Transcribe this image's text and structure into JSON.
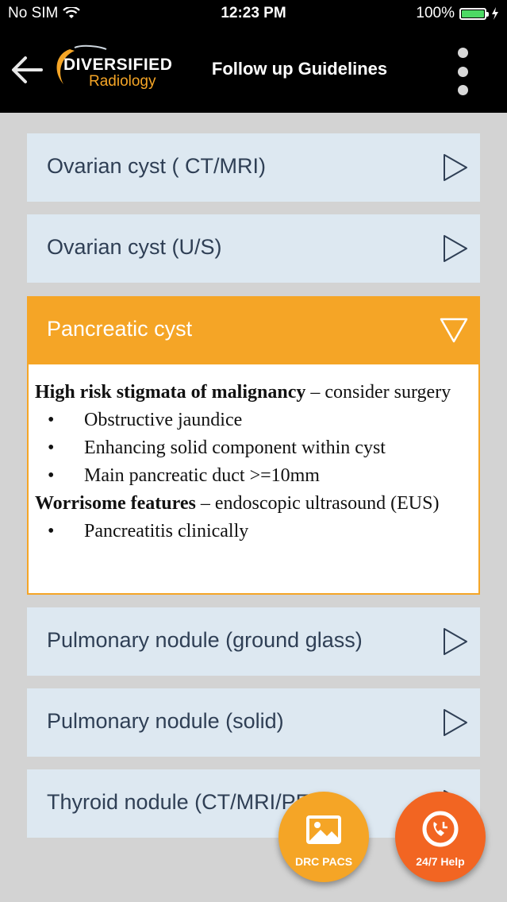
{
  "status": {
    "carrier": "No SIM",
    "time": "12:23 PM",
    "battery": "100%"
  },
  "header": {
    "logo_line1": "DIVERSIFIED",
    "logo_line2": "Radiology",
    "title": "Follow up Guidelines",
    "back_icon": "arrow-left-icon",
    "menu_icon": "vertical-dots-icon"
  },
  "colors": {
    "accent": "#f5a526",
    "row_bg": "#dde8f1",
    "text": "#2f3f55",
    "help": "#f26522"
  },
  "list": {
    "items": [
      {
        "label": "Ovarian cyst ( CT/MRI)"
      },
      {
        "label": "Ovarian cyst (U/S)"
      },
      {
        "label": "Pancreatic cyst"
      },
      {
        "label": "Pulmonary nodule (ground glass)"
      },
      {
        "label": "Pulmonary nodule (solid)"
      },
      {
        "label": "Thyroid nodule (CT/MRI/PET)"
      }
    ]
  },
  "detail": {
    "heading1": "High risk stigmata of malignancy",
    "heading1_rest": " – consider surgery",
    "list1": [
      "Obstructive jaundice",
      "Enhancing solid component within cyst",
      "Main pancreatic duct >=10mm"
    ],
    "heading2": "Worrisome features",
    "heading2_rest": " – endoscopic ultrasound (EUS)",
    "list2": [
      "Pancreatitis clinically"
    ]
  },
  "fabs": {
    "pacs_label": "DRC PACS",
    "pacs_icon": "image-icon",
    "help_label": "24/7 Help",
    "help_icon": "phone-clock-icon"
  }
}
